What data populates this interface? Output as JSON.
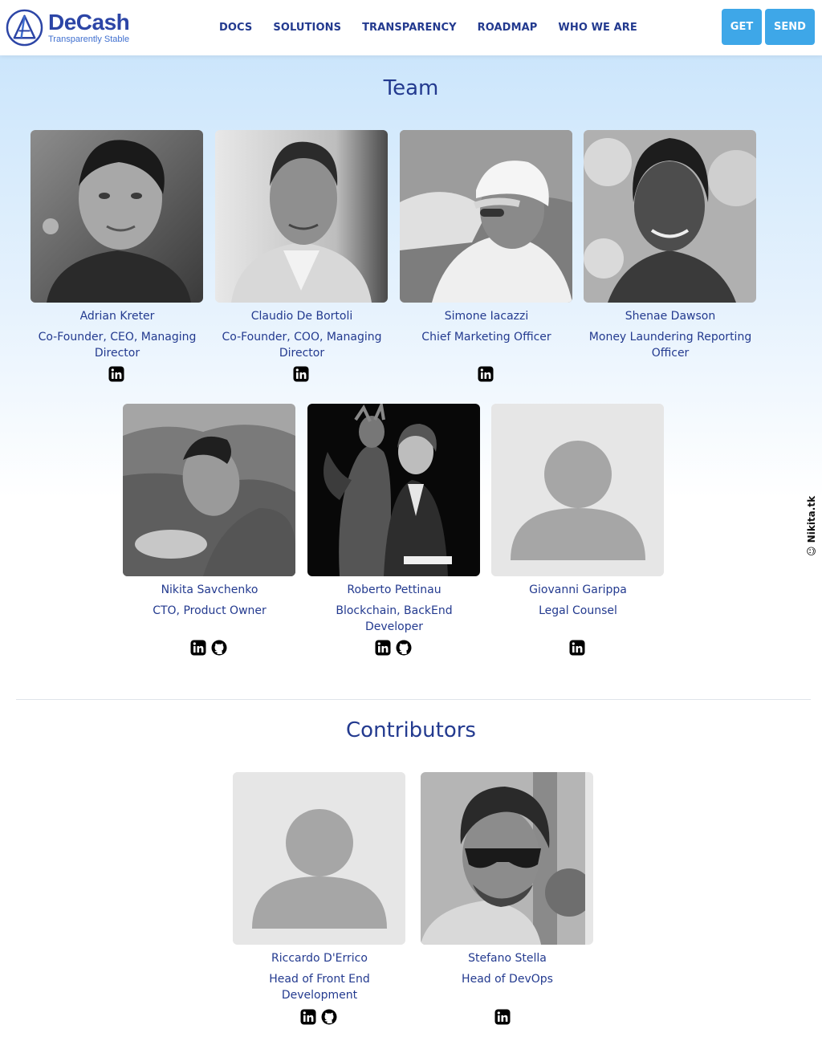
{
  "header": {
    "brand_name": "DeCash",
    "brand_tagline": "Transparently Stable",
    "nav": [
      "DOCS",
      "SOLUTIONS",
      "TRANSPARENCY",
      "ROADMAP",
      "WHO WE ARE"
    ],
    "get_label": "GET",
    "send_label": "SEND",
    "accent_color": "#3ea7e8",
    "brand_color": "#2c45a6"
  },
  "team": {
    "title": "Team",
    "members": [
      {
        "name": "Adrian Kreter",
        "role": "Co-Founder, CEO, Managing Director",
        "icons": [
          "linkedin-icon"
        ]
      },
      {
        "name": "Claudio De Bortoli",
        "role": "Co-Founder, COO, Managing Director",
        "icons": [
          "linkedin-icon"
        ]
      },
      {
        "name": "Simone Iacazzi",
        "role": "Chief Marketing Officer",
        "icons": [
          "linkedin-icon"
        ]
      },
      {
        "name": "Shenae Dawson",
        "role": "Money Laundering Reporting Officer",
        "icons": [
          "linkedin-icon"
        ]
      },
      {
        "name": "Nikita Savchenko",
        "role": "CTO, Product Owner",
        "icons": [
          "linkedin-icon",
          "github-icon"
        ]
      },
      {
        "name": "Roberto Pettinau",
        "role": "Blockchain, BackEnd Developer",
        "icons": [
          "linkedin-icon",
          "github-icon"
        ]
      },
      {
        "name": "Giovanni Garippa",
        "role": "Legal Counsel",
        "icons": [
          "linkedin-icon"
        ]
      }
    ]
  },
  "contributors": {
    "title": "Contributors",
    "members": [
      {
        "name": "Riccardo D'Errico",
        "role": "Head of Front End Development",
        "icons": [
          "linkedin-icon",
          "github-icon"
        ]
      },
      {
        "name": "Stefano Stella",
        "role": "Head of DevOps",
        "icons": [
          "linkedin-icon"
        ]
      }
    ]
  },
  "watermark": "Nikita.tk"
}
